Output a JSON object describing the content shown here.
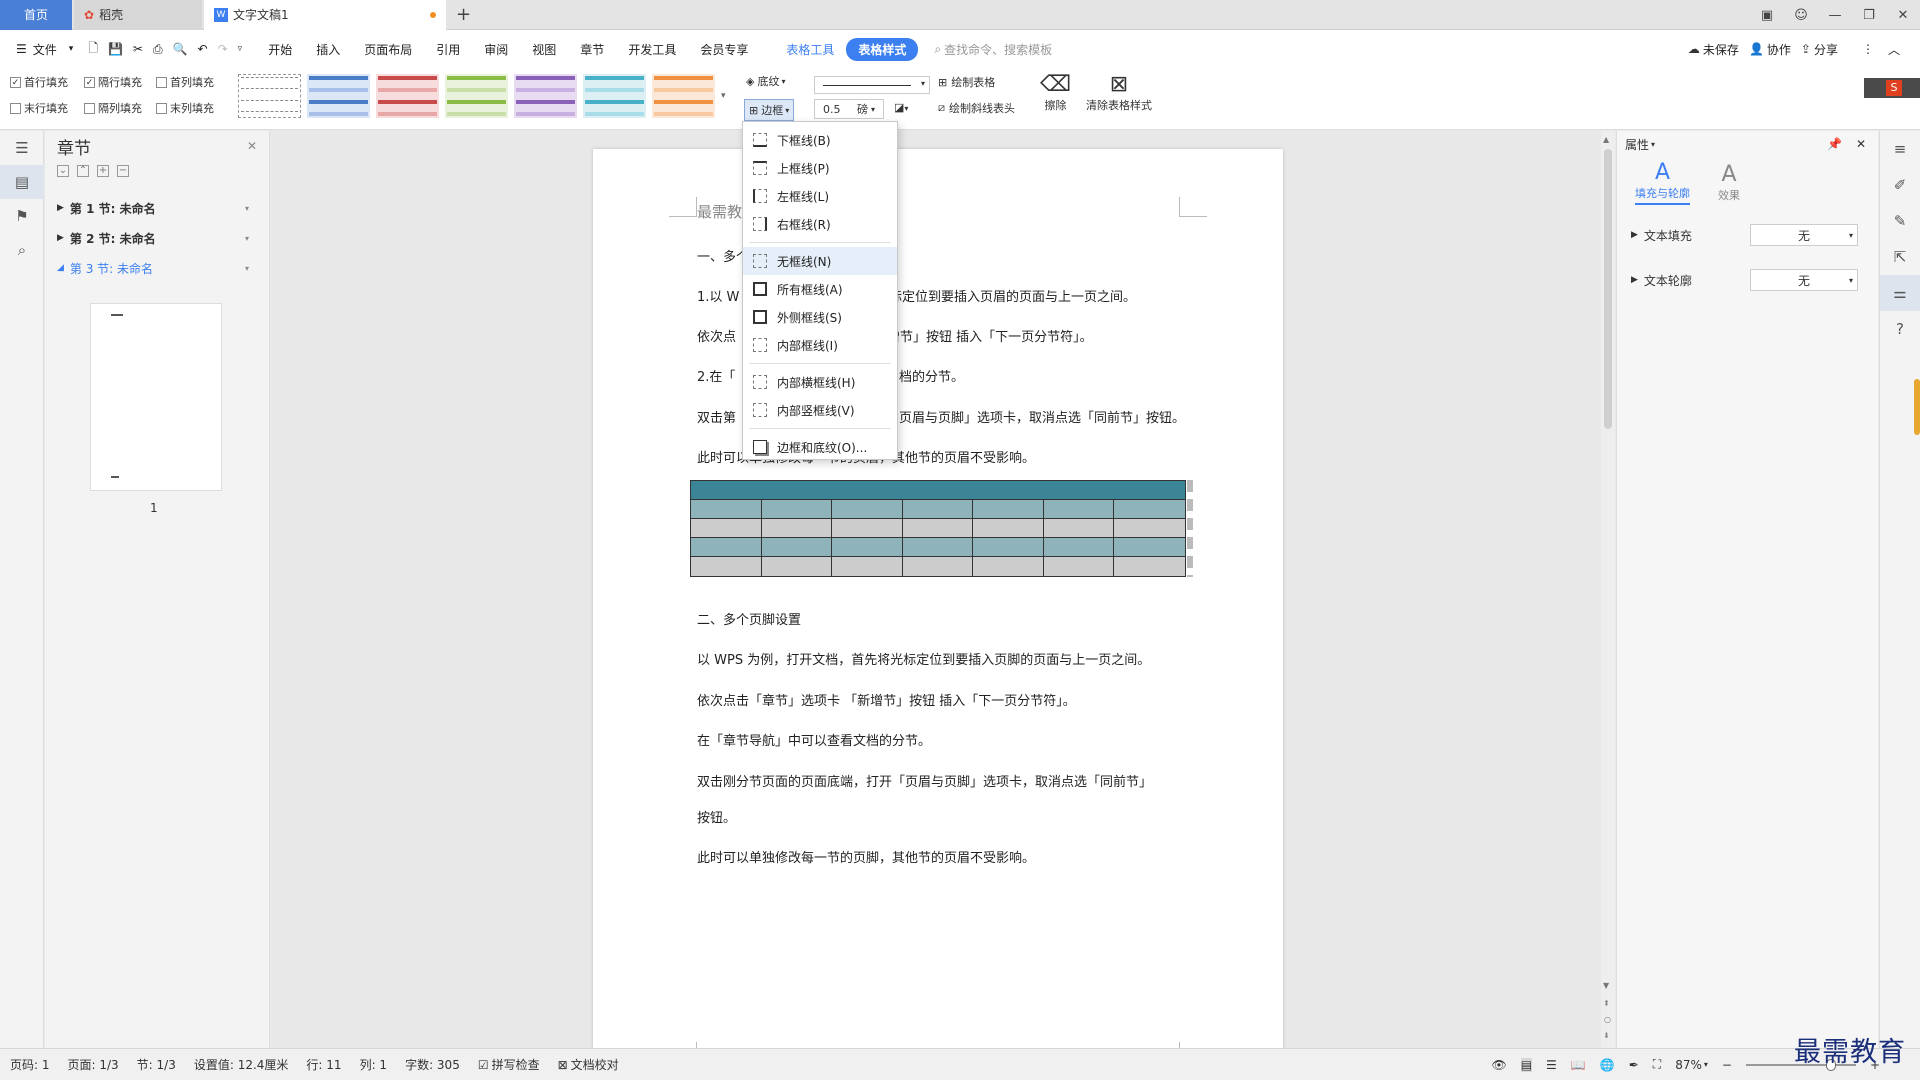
{
  "tabs": {
    "home": "首页",
    "daoke": "稻壳",
    "doc": "文字文稿1",
    "new": "+"
  },
  "menus": [
    "文件",
    "开始",
    "插入",
    "页面布局",
    "引用",
    "审阅",
    "视图",
    "章节",
    "开发工具",
    "会员专享",
    "表格工具",
    "表格样式"
  ],
  "search_placeholder": "查找命令、搜索模板",
  "menu_right": {
    "unsaved": "未保存",
    "collab": "协作",
    "share": "分享"
  },
  "ribbon": {
    "checks": [
      {
        "label": "首行填充",
        "checked": true
      },
      {
        "label": "隔行填充",
        "checked": true
      },
      {
        "label": "首列填充",
        "checked": false
      },
      {
        "label": "末行填充",
        "checked": false
      },
      {
        "label": "隔列填充",
        "checked": false
      },
      {
        "label": "末列填充",
        "checked": false
      }
    ],
    "shading": "底纹",
    "border": "边框",
    "line_width": "0.5",
    "unit": "磅",
    "draw_table": "绘制表格",
    "draw_diag": "绘制斜线表头",
    "erase": "擦除",
    "clear_style": "清除表格样式",
    "style_colors": [
      "#888888",
      "#4a7cc8",
      "#c84a4a",
      "#8cbc48",
      "#8a60b8",
      "#48b0c8",
      "#f09040"
    ]
  },
  "nav": {
    "title": "章节",
    "items": [
      {
        "label": "第 1 节: 未命名"
      },
      {
        "label": "第 2 节: 未命名"
      },
      {
        "label": "第 3 节: 未命名"
      }
    ],
    "page_num": "1"
  },
  "doc": {
    "p0": "最需教",
    "h1": "一、多个",
    "p1a": "1.以 W",
    "p1b": "将光标定位到要插入页眉的页面与上一页之间。",
    "p2a": "依次点",
    "p2b": "增节」按钮 插入「下一页分节符」。",
    "p3a": "2.在「",
    "p3b": "档的分节。",
    "p4a": "双击第",
    "p4b": "页眉与页脚」选项卡，取消点选「同前节」按钮。",
    "p5": "此时可以单独修改每一节的页眉，其他节的页眉不受影响。",
    "h2": "二、多个页脚设置",
    "q1": "以 WPS 为例，打开文档，首先将光标定位到要插入页脚的页面与上一页之间。",
    "q2": "依次点击「章节」选项卡 「新增节」按钮 插入「下一页分节符」。",
    "q3": " 在「章节导航」中可以查看文档的分节。",
    "q4": "双击刚分节页面的页面底端，打开「页眉与页脚」选项卡，取消点选「同前节」",
    "q5": "按钮。",
    "q6": "此时可以单独修改每一节的页脚，其他节的页眉不受影响。",
    "table": {
      "rows": 5,
      "cols": 7,
      "header_color": "#3b8596",
      "band_color": "#8fb3ba",
      "alt_color": "#cccccc"
    }
  },
  "dropdown": [
    "下框线(B)",
    "上框线(P)",
    "左框线(L)",
    "右框线(R)",
    "无框线(N)",
    "所有框线(A)",
    "外侧框线(S)",
    "内部框线(I)",
    "内部横框线(H)",
    "内部竖框线(V)",
    "边框和底纹(O)..."
  ],
  "props": {
    "title": "属性",
    "tab1": "填充与轮廓",
    "tab2": "效果",
    "text_fill": "文本填充",
    "text_outline": "文本轮廓",
    "none": "无"
  },
  "status": {
    "page": "页码: 1",
    "pages": "页面: 1/3",
    "section": "节: 1/3",
    "setting": "设置值: 12.4厘米",
    "line": "行: 11",
    "col": "列: 1",
    "words": "字数: 305",
    "spell": "拼写检查",
    "proof": "文档校对",
    "zoom": "87%"
  },
  "watermark": "最需教育"
}
